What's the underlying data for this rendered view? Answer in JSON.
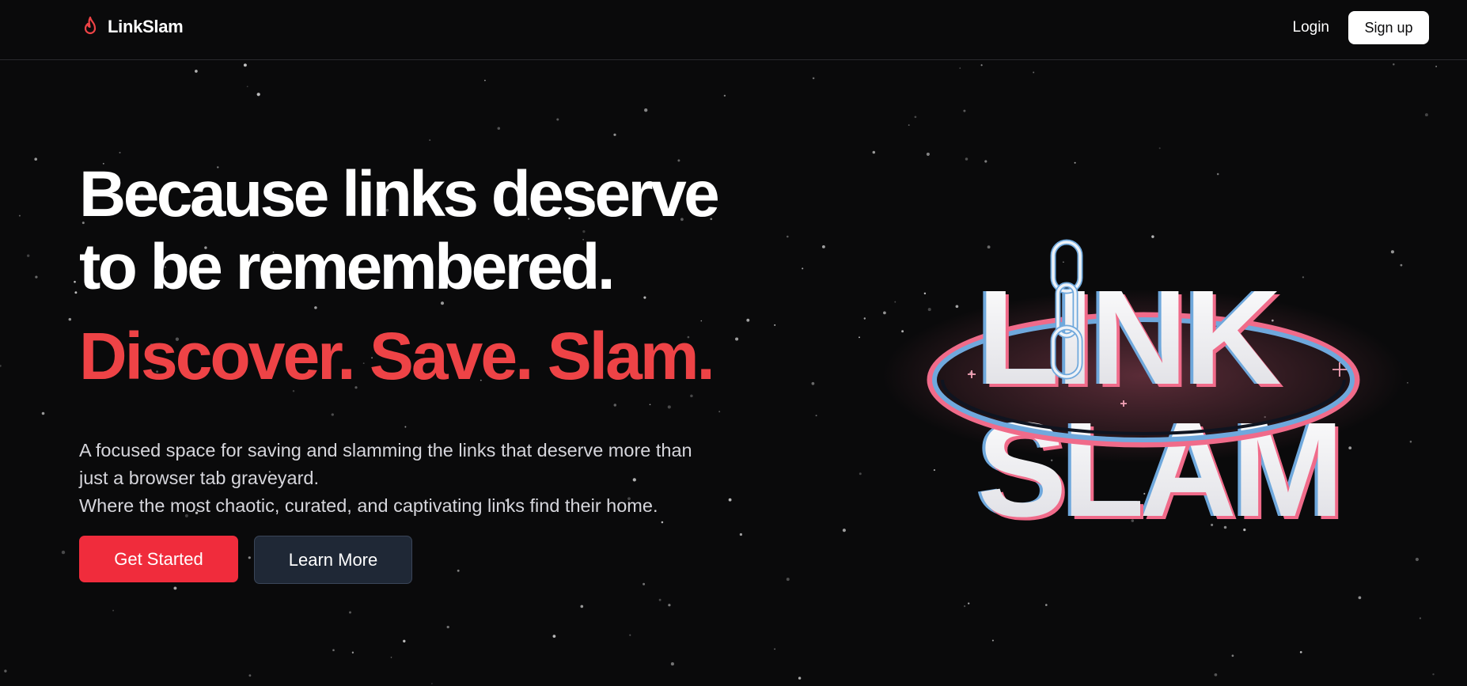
{
  "app": {
    "name": "LinkSlam",
    "brand_color": "#ee4346"
  },
  "nav": {
    "logo_icon": "flame-icon",
    "login_label": "Login",
    "signup_label": "Sign up"
  },
  "hero": {
    "headline_line1": "Because links deserve",
    "headline_line2": "to be remembered.",
    "tagline": "Discover. Save. Slam.",
    "description_line1": "A focused space for saving and slamming the links that deserve more than",
    "description_line2": "just a browser tab graveyard.",
    "description_line3": "Where the most chaotic, curated, and captivating links find their home.",
    "primary_cta": "Get Started",
    "secondary_cta": "Learn More"
  },
  "logo_art": {
    "word1": "LINK",
    "word2": "SLAM",
    "icon": "chain-link-icon",
    "ring_colors": [
      "#6fa8dc",
      "#f06b8a"
    ]
  },
  "colors": {
    "background": "#0a0a0b",
    "primary_button": "#f02c3c",
    "secondary_button": "#1f2836"
  }
}
